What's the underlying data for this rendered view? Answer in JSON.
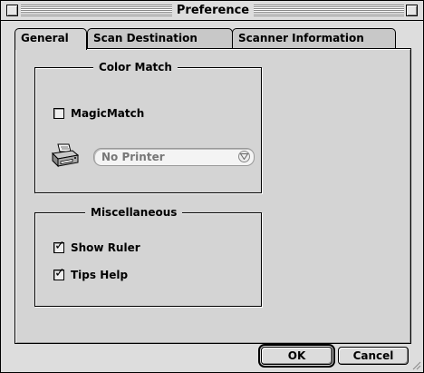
{
  "window": {
    "title": "Preference"
  },
  "tabs": [
    {
      "label": "General",
      "active": true
    },
    {
      "label": "Scan Destination",
      "active": false
    },
    {
      "label": "Scanner Information",
      "active": false
    }
  ],
  "color_match": {
    "legend": "Color Match",
    "magic_match": {
      "label": "MagicMatch",
      "checked": false
    },
    "printer_popup": {
      "value": "No Printer"
    }
  },
  "miscellaneous": {
    "legend": "Miscellaneous",
    "show_ruler": {
      "label": "Show Ruler",
      "checked": true
    },
    "tips_help": {
      "label": "Tips Help",
      "checked": true
    }
  },
  "buttons": {
    "ok": "OK",
    "cancel": "Cancel"
  },
  "icons": {
    "close": "close-box-icon",
    "zoom": "zoom-box-icon",
    "printer": "printer-icon",
    "checkmark": "✓"
  }
}
